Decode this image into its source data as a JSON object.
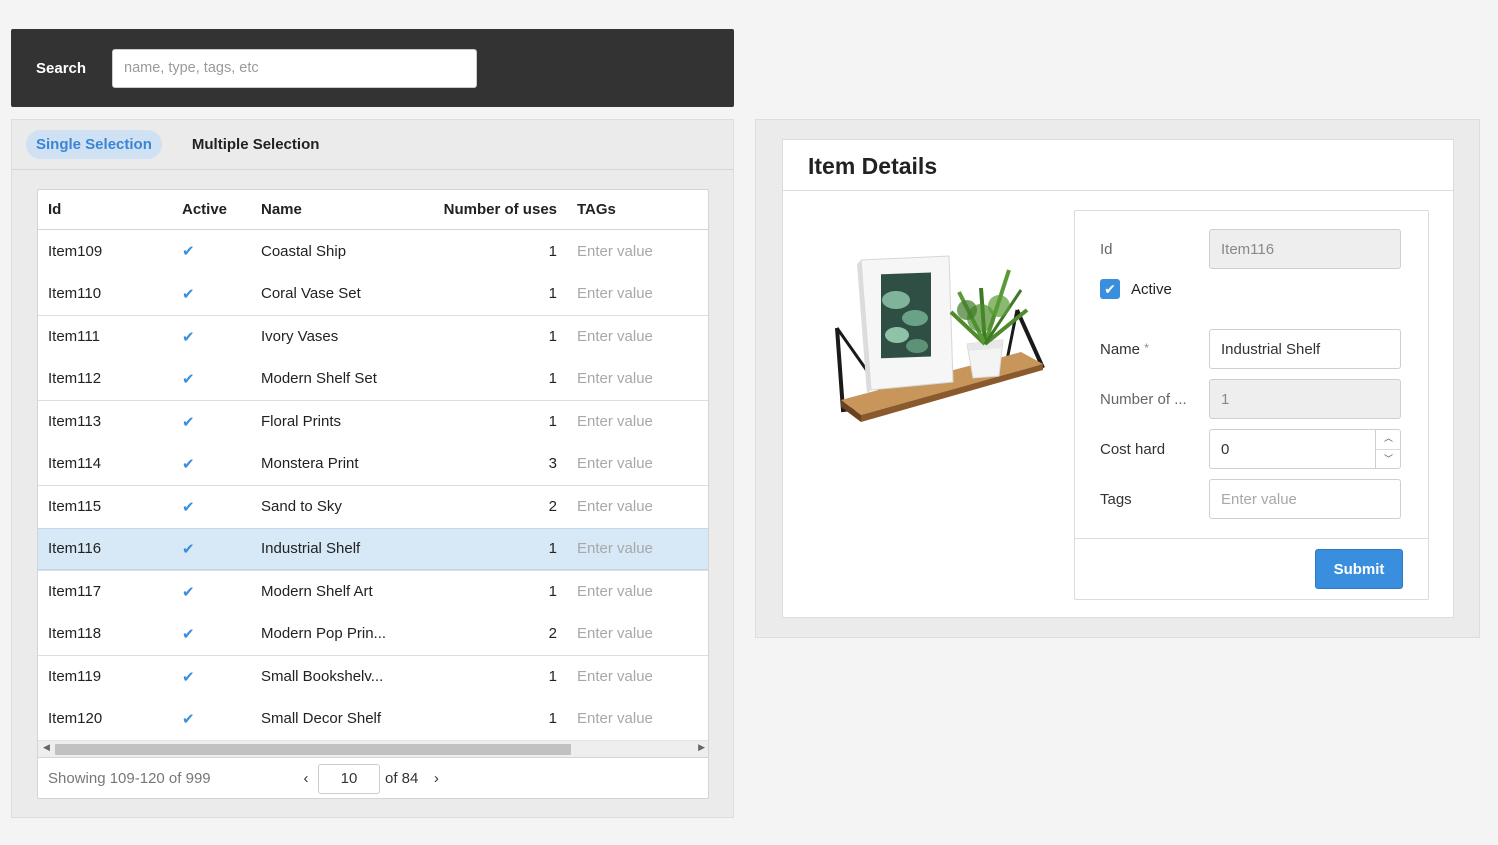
{
  "search": {
    "label": "Search",
    "placeholder": "name, type, tags, etc"
  },
  "tabs": [
    {
      "label": "Single Selection",
      "active": true
    },
    {
      "label": "Multiple Selection",
      "active": false
    }
  ],
  "grid": {
    "columns": [
      "Id",
      "Active",
      "Name",
      "Number of uses",
      "TAGs"
    ],
    "tags_placeholder": "Enter value",
    "rows": [
      {
        "id": "Item109",
        "active": "✔",
        "name": "Coastal Ship",
        "uses": "1"
      },
      {
        "id": "Item110",
        "active": "✔",
        "name": "Coral Vase Set",
        "uses": "1"
      },
      {
        "id": "Item111",
        "active": "✔",
        "name": "Ivory Vases",
        "uses": "1"
      },
      {
        "id": "Item112",
        "active": "✔",
        "name": "Modern Shelf Set",
        "uses": "1"
      },
      {
        "id": "Item113",
        "active": "✔",
        "name": "Floral Prints",
        "uses": "1"
      },
      {
        "id": "Item114",
        "active": "✔",
        "name": "Monstera Print",
        "uses": "3"
      },
      {
        "id": "Item115",
        "active": "✔",
        "name": "Sand to Sky",
        "uses": "2"
      },
      {
        "id": "Item116",
        "active": "✔",
        "name": "Industrial Shelf",
        "uses": "1"
      },
      {
        "id": "Item117",
        "active": "✔",
        "name": "Modern Shelf Art",
        "uses": "1"
      },
      {
        "id": "Item118",
        "active": "✔",
        "name": "Modern Pop Prin...",
        "uses": "2"
      },
      {
        "id": "Item119",
        "active": "✔",
        "name": "Small Bookshelv...",
        "uses": "1"
      },
      {
        "id": "Item120",
        "active": "✔",
        "name": "Small Decor Shelf",
        "uses": "1"
      }
    ],
    "selected_index": 7
  },
  "pager": {
    "info": "Showing 109-120 of 999",
    "page": "10",
    "of_label": "of 84",
    "prev_icon": "‹",
    "next_icon": "›"
  },
  "details": {
    "title": "Item Details",
    "fields": {
      "id_label": "Id",
      "id_value": "Item116",
      "active_label": "Active",
      "active_checked": true,
      "name_label": "Name",
      "name_required": "*",
      "name_value": "Industrial Shelf",
      "uses_label": "Number of ...",
      "uses_value": "1",
      "cost_label": "Cost hard",
      "cost_value": "0",
      "tags_label": "Tags",
      "tags_placeholder": "Enter value"
    },
    "submit_label": "Submit"
  },
  "colors": {
    "accent": "#3a8ede",
    "header_bar": "#333333",
    "selected_row": "#d7e8f7",
    "tab_active_bg": "#cfe1f3"
  },
  "icons": {
    "check": "check-icon",
    "stepper_up": "chevron-up-icon",
    "stepper_down": "chevron-down-icon",
    "scroll_left": "scroll-left-arrow-icon",
    "scroll_right": "scroll-right-arrow-icon"
  }
}
